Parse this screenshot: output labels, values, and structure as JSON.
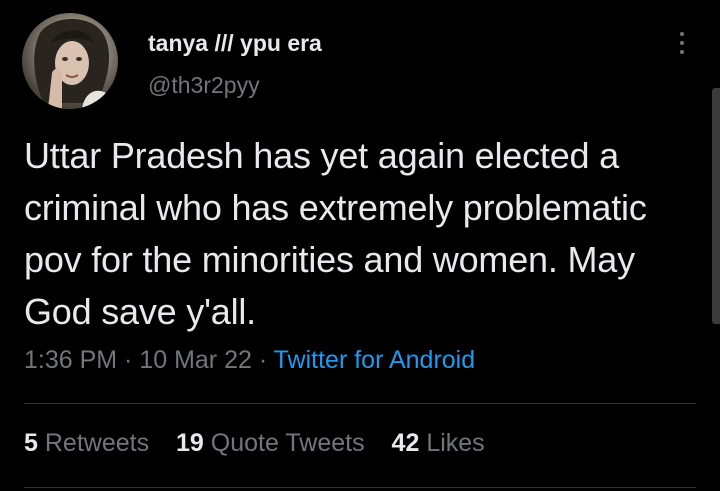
{
  "author": {
    "display_name": "tanya /// ypu era",
    "handle": "@th3r2pyy"
  },
  "tweet": {
    "text": "Uttar Pradesh has yet again elected a criminal who has extremely problematic pov for the minorities and women. May God save y'all.",
    "time": "1:36 PM",
    "separator1": " · ",
    "date": "10 Mar 22",
    "separator2": " · ",
    "source": "Twitter for Android"
  },
  "stats": {
    "retweets_count": "5",
    "retweets_label": "Retweets",
    "quotes_count": "19",
    "quotes_label": "Quote Tweets",
    "likes_count": "42",
    "likes_label": "Likes"
  },
  "icons": {
    "more": "more-vertical-icon",
    "avatar": "avatar"
  },
  "colors": {
    "background": "#000000",
    "text": "#e7e9ea",
    "muted": "#71767b",
    "link": "#1d9bf0",
    "divider": "#2f3336"
  }
}
